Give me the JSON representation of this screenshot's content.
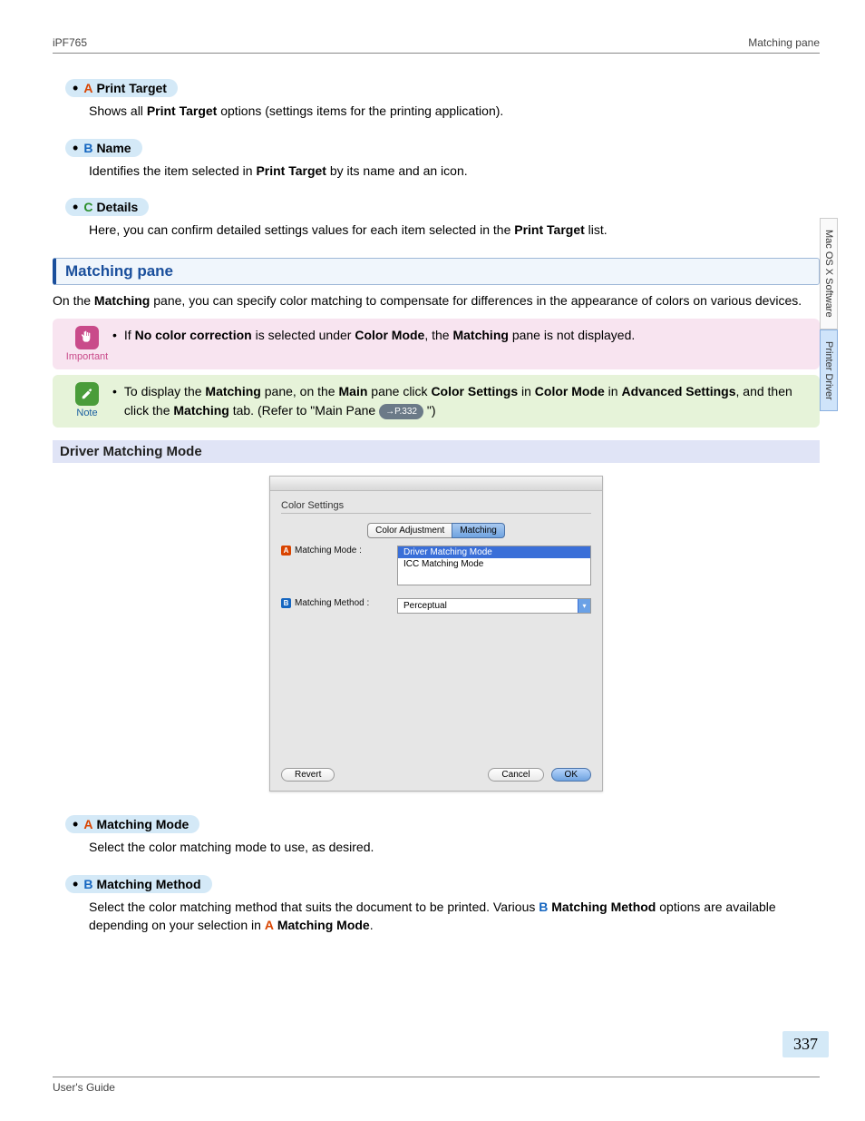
{
  "header": {
    "left": "iPF765",
    "right": "Matching pane"
  },
  "items_top": [
    {
      "letter": "A",
      "cls": "la",
      "title": "Print Target",
      "desc_pre": "Shows all ",
      "desc_bold": "Print Target",
      "desc_post": " options (settings items for the printing application)."
    },
    {
      "letter": "B",
      "cls": "lb",
      "title": "Name",
      "desc_pre": "Identifies the item selected in ",
      "desc_bold": "Print Target",
      "desc_post": " by its name and an icon."
    },
    {
      "letter": "C",
      "cls": "lc",
      "title": "Details",
      "desc_pre": "Here, you can confirm detailed settings values for each item selected in the ",
      "desc_bold": "Print Target",
      "desc_post": " list."
    }
  ],
  "section": {
    "title": "Matching pane",
    "intro_parts": [
      "On the ",
      "Matching",
      " pane, you can specify color matching to compensate for differences in the appearance of colors on various devices."
    ]
  },
  "important": {
    "label": "Important",
    "text_parts": [
      "If ",
      "No color correction",
      " is selected under ",
      "Color Mode",
      ", the ",
      "Matching",
      " pane is not displayed."
    ]
  },
  "note": {
    "label": "Note",
    "text_parts": [
      "To display the ",
      "Matching",
      " pane, on the ",
      "Main",
      " pane click ",
      "Color Settings",
      " in ",
      "Color Mode",
      " in ",
      "Advanced Settings",
      ", and then click the ",
      "Matching",
      " tab. (Refer to \"Main Pane "
    ],
    "page_ref": "→P.332",
    "text_tail": " \")"
  },
  "subheading": "Driver Matching Mode",
  "dialog": {
    "title": "Color Settings",
    "tabs": {
      "inactive": "Color Adjustment",
      "active": "Matching"
    },
    "row_a": {
      "label": "Matching Mode :",
      "opt_sel": "Driver Matching Mode",
      "opt2": "ICC Matching Mode"
    },
    "row_b": {
      "label": "Matching Method :",
      "value": "Perceptual"
    },
    "buttons": {
      "revert": "Revert",
      "cancel": "Cancel",
      "ok": "OK"
    }
  },
  "items_bottom": {
    "a": {
      "letter": "A",
      "title": "Matching Mode",
      "desc": "Select the color matching mode to use, as desired."
    },
    "b": {
      "letter": "B",
      "title": "Matching Method",
      "line1_parts": [
        "Select the color matching method that suits the document to be printed. Various ",
        "B",
        "Matching Method",
        " options are available depending on your selection in ",
        "A",
        "Matching Mode",
        "."
      ]
    }
  },
  "side_tabs": {
    "t1": "Mac OS X Software",
    "t2": "Printer Driver"
  },
  "page_number": "337",
  "footer": "User's Guide"
}
